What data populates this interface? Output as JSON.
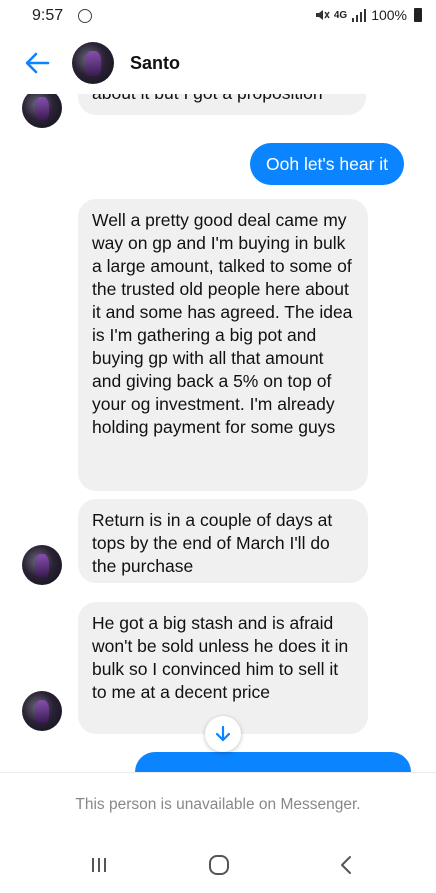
{
  "status_bar": {
    "time": "9:57",
    "network": "4G",
    "battery": "100%"
  },
  "header": {
    "contact_name": "Santo"
  },
  "messages": [
    {
      "direction": "in",
      "text": "about it but I got a proposition"
    },
    {
      "direction": "out",
      "text": "Ooh let's hear it"
    },
    {
      "direction": "in",
      "text": "Well a pretty good deal came my way on gp and I'm buying in bulk a large amount, talked to some of the trusted old people here about it and some has agreed. The idea is I'm gathering a big pot and buying gp with all that amount and giving back a 5% on top of your og investment. I'm already holding payment for some guys"
    },
    {
      "direction": "in",
      "text": "Return is in a couple of days at tops by the end of March I'll do the purchase"
    },
    {
      "direction": "in",
      "text": "He got a big stash and is afraid won't be sold unless he does it in bulk so I convinced him to sell it to me at a decent price"
    }
  ],
  "footer": {
    "unavailable_text": "This person is unavailable on Messenger."
  },
  "colors": {
    "accent": "#0a84ff",
    "incoming_bubble": "#f0f0f0"
  },
  "icons": {
    "back": "back-arrow-icon",
    "scroll": "arrow-down-icon",
    "nav_recents": "recents-icon",
    "nav_home": "home-icon",
    "nav_back": "nav-back-icon"
  }
}
